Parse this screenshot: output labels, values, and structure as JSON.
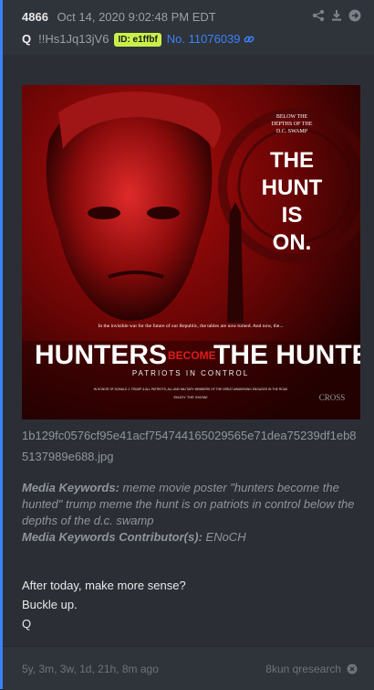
{
  "post": {
    "number": "4866",
    "date": "Oct 14, 2020 9:02:48 PM EDT",
    "author": "Q",
    "tripcode": "!!Hs1Jq13jV6",
    "id_badge": "ID: e1ffbf",
    "post_link": "No. 11076039"
  },
  "header_icons": [
    "share-icon",
    "download-icon",
    "arrow-right-circle-icon"
  ],
  "poster": {
    "top_small": [
      "BELOW THE",
      "DEPTHS OF THE",
      "D.C. SWAMP"
    ],
    "big": [
      "THE",
      "HUNT",
      "IS",
      "ON."
    ],
    "tagline": "In the invisible war for the future of our Republic, the tables are now turned. And now, the...",
    "title_left": "HUNTERS",
    "title_mid": "BECOME",
    "title_right": "THE HUNTED",
    "subtitle": "PATRIOTS IN CONTROL",
    "credits": "IN HONOR OF DONALD J. TRUMP & ALL PATRIOTS, ALL AND MILITARY MEMBERS OF THE GREAT AWAKENING ENGAGED IN THE ROAD",
    "enjoy": "ENJOY THE SHOW!",
    "logo": "CROSS"
  },
  "filename": "1b129fc0576cf95e41acf754744165029565e71dea75239df1eb85137989e688.jpg",
  "keywords": {
    "label": "Media Keywords:",
    "text": " meme movie poster \"hunters become the hunted\" trump meme the hunt is on patriots in control below the depths of the d.c. swamp",
    "contrib_label": "Media Keywords Contributor(s):",
    "contrib_text": " ENoCH"
  },
  "message": [
    "After today, make more sense?",
    "Buckle up.",
    "Q"
  ],
  "footer": {
    "ago": "5y, 3m, 3w, 1d, 21h, 8m ago",
    "source": "8kun qresearch"
  },
  "colors": {
    "accent": "#3b82f6",
    "id_badge": "#c9f04a",
    "card": "#2b2f35"
  }
}
